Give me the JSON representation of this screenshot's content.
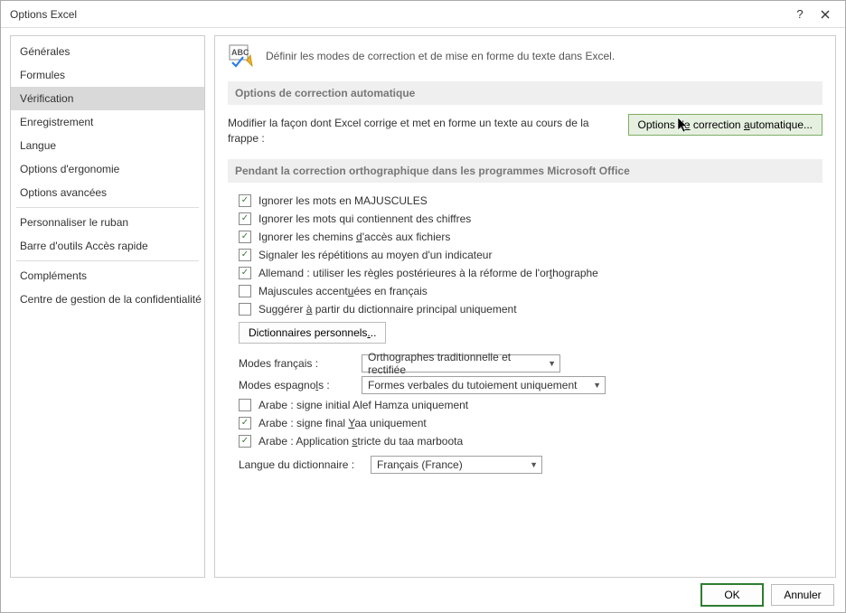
{
  "window": {
    "title": "Options Excel"
  },
  "sidebar": {
    "items": [
      {
        "label": "Générales"
      },
      {
        "label": "Formules"
      },
      {
        "label": "Vérification"
      },
      {
        "label": "Enregistrement"
      },
      {
        "label": "Langue"
      },
      {
        "label": "Options d'ergonomie"
      },
      {
        "label": "Options avancées"
      },
      {
        "label": "Personnaliser le ruban"
      },
      {
        "label": "Barre d'outils Accès rapide"
      },
      {
        "label": "Compléments"
      },
      {
        "label": "Centre de gestion de la confidentialité"
      }
    ]
  },
  "header": {
    "text": "Définir les modes de correction et de mise en forme du texte dans Excel."
  },
  "sections": {
    "autocorrect": {
      "title": "Options de correction automatique",
      "desc": "Modifier la façon dont Excel corrige et met en forme un texte au cours de la frappe :",
      "button": "Options de correction automatique..."
    },
    "spelling": {
      "title": "Pendant la correction orthographique dans les programmes Microsoft Office",
      "checkboxes": [
        {
          "label": "Ignorer les mots en MAJUSCULES",
          "checked": true
        },
        {
          "label": "Ignorer les mots qui contiennent des chiffres",
          "checked": true
        },
        {
          "label": "Ignorer les chemins d'accès aux fichiers",
          "checked": true
        },
        {
          "label": "Signaler les répétitions au moyen d'un indicateur",
          "checked": true
        },
        {
          "label": "Allemand : utiliser les règles postérieures à la réforme de l'orthographe",
          "checked": true
        },
        {
          "label": "Majuscules accentuées en français",
          "checked": false
        },
        {
          "label": "Suggérer à partir du dictionnaire principal uniquement",
          "checked": false
        }
      ],
      "dict_button": "Dictionnaires personnels...",
      "french_modes": {
        "label": "Modes français :",
        "value": "Orthographes traditionnelle et rectifiée"
      },
      "spanish_modes": {
        "label": "Modes espagnols :",
        "value": "Formes verbales du tutoiement uniquement"
      },
      "arabic": [
        {
          "label": "Arabe : signe initial Alef Hamza uniquement",
          "checked": false
        },
        {
          "label": "Arabe : signe final Yaa uniquement",
          "checked": true
        },
        {
          "label": "Arabe : Application stricte du taa marboota",
          "checked": true
        }
      ],
      "dict_lang": {
        "label": "Langue du dictionnaire :",
        "value": "Français (France)"
      }
    }
  },
  "footer": {
    "ok": "OK",
    "cancel": "Annuler"
  }
}
